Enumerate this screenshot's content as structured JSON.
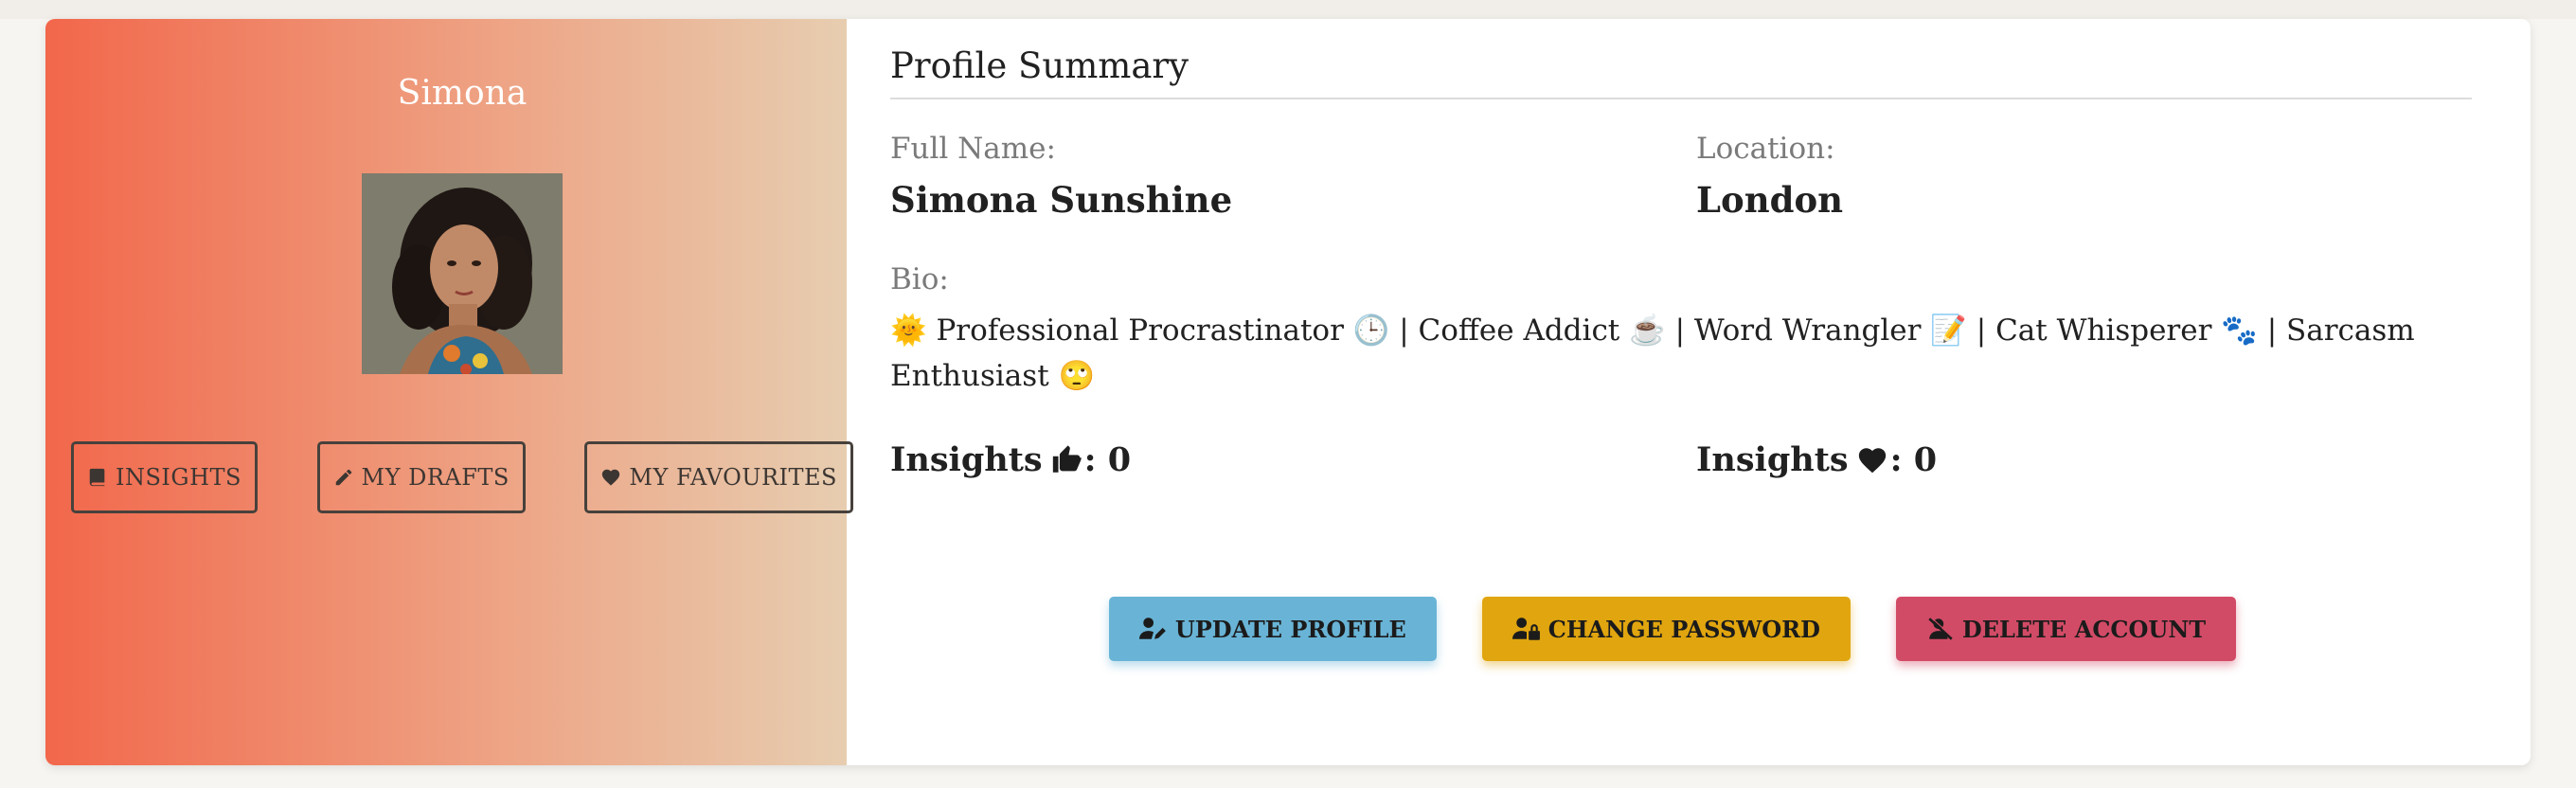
{
  "profile": {
    "username": "Simona",
    "avatar_alt": "profile photo"
  },
  "nav": {
    "insights_label": "INSIGHTS",
    "drafts_label": "MY DRAFTS",
    "favourites_label": "MY FAVOURITES"
  },
  "summary": {
    "title": "Profile Summary",
    "full_name_label": "Full Name:",
    "full_name_value": "Simona Sunshine",
    "location_label": "Location:",
    "location_value": "London",
    "bio_label": "Bio:",
    "bio_text": "🌞 Professional Procrastinator 🕒 | Coffee Addict ☕ | Word Wrangler 📝 | Cat Whisperer 🐾 | Sarcasm Enthusiast 🙄"
  },
  "stats": {
    "likes_label": "Insights",
    "likes_count": ": 0",
    "hearts_label": "Insights",
    "hearts_count": ": 0"
  },
  "actions": {
    "update_label": "UPDATE PROFILE",
    "password_label": "CHANGE PASSWORD",
    "delete_label": "DELETE ACCOUNT"
  },
  "colors": {
    "gradient_start": "#f2674b",
    "gradient_end": "#e7cdb0",
    "update_btn": "#69b4d6",
    "password_btn": "#e0a50f",
    "delete_btn": "#d24b66"
  },
  "icons": {
    "insights": "book-icon",
    "drafts": "pencil-icon",
    "favourites": "heart-icon",
    "likes": "thumbs-up-icon",
    "hearts": "heart-icon",
    "update": "user-edit-icon",
    "password": "user-lock-icon",
    "delete": "user-slash-icon"
  }
}
